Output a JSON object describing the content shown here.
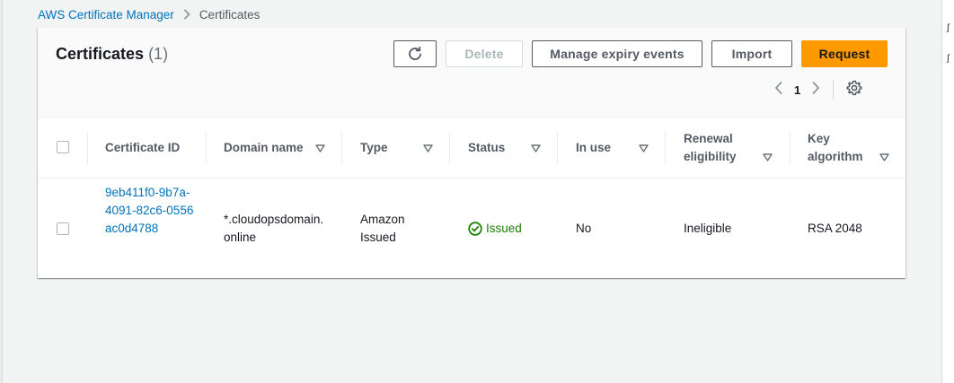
{
  "breadcrumb": {
    "root": "AWS Certificate Manager",
    "current": "Certificates"
  },
  "header": {
    "title": "Certificates",
    "count": "(1)"
  },
  "toolbar": {
    "refresh_icon": "refresh-icon",
    "delete_label": "Delete",
    "manage_expiry_label": "Manage expiry events",
    "import_label": "Import",
    "request_label": "Request"
  },
  "pagination": {
    "current_page": "1"
  },
  "table": {
    "columns": [
      {
        "label": "Certificate ID"
      },
      {
        "label": "Domain name"
      },
      {
        "label": "Type"
      },
      {
        "label": "Status"
      },
      {
        "label": "In use"
      },
      {
        "label": "Renewal eligibility"
      },
      {
        "label": "Key algorithm"
      }
    ],
    "rows": [
      {
        "certificate_id": "9eb411f0-9b7a-4091-82c6-0556ac0d4788",
        "domain_name": "*.cloudopsdomain.online",
        "type": "Amazon Issued",
        "status": "Issued",
        "in_use": "No",
        "renewal_eligibility": "Ineligible",
        "key_algorithm": "RSA 2048"
      }
    ]
  },
  "colors": {
    "link": "#0073bb",
    "primary_button": "#ff9900",
    "success": "#1d8102"
  }
}
